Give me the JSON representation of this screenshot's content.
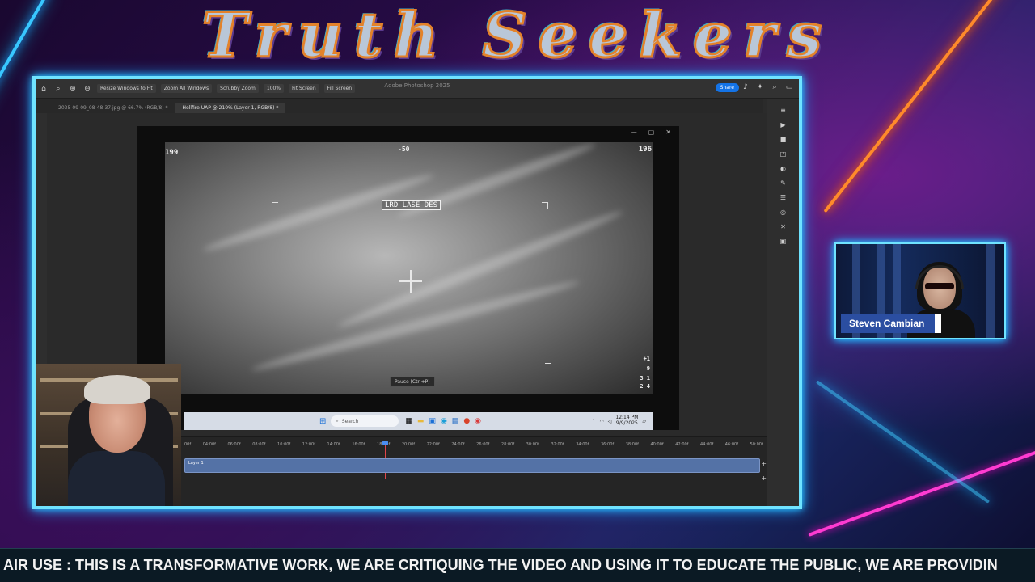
{
  "banner": {
    "title": "Truth Seekers"
  },
  "photoshop": {
    "app_title": "Adobe Photoshop 2025",
    "toolbar": {
      "resize_windows": "Resize Windows to Fit",
      "zoom_all": "Zoom All Windows",
      "scrubby_zoom": "Scrubby Zoom",
      "zoom_level": "100%",
      "fit_screen": "Fit Screen",
      "fill_screen": "Fill Screen",
      "share": "Share"
    },
    "tabs": [
      {
        "label": "2025-09-09_08-48-37.jpg @ 66.7% (RGB/8) *"
      },
      {
        "label": "Hellfire UAP @ 210% (Layer 1, RGB/8) *"
      }
    ],
    "timeline": {
      "ticks": [
        "00f",
        "04:00f",
        "06:00f",
        "08:00f",
        "10:00f",
        "12:00f",
        "14:00f",
        "16:00f",
        "18:00f",
        "20:00f",
        "22:00f",
        "24:00f",
        "26:00f",
        "28:00f",
        "30:00f",
        "32:00f",
        "34:00f",
        "36:00f",
        "38:00f",
        "40:00f",
        "42:00f",
        "44:00f",
        "46:00f",
        "50:00f"
      ],
      "layer": "Layer 1"
    }
  },
  "video": {
    "hud_top_left": "199",
    "hud_top_center": "-50",
    "hud_top_right": "196",
    "hud_box": "LRD LASE DES",
    "hud_bottom_right_1": "+1",
    "hud_bottom_right_2": "9",
    "hud_bottom_right_3": "3 1",
    "hud_bottom_right_4": "2 4",
    "tooltip": "Pause (Ctrl+P)"
  },
  "taskbar": {
    "search_placeholder": "Search",
    "time": "12:14 PM",
    "date": "9/9/2025"
  },
  "webcam_right": {
    "name": "Steven Cambian"
  },
  "ticker": {
    "text": "AIR USE : THIS IS A TRANSFORMATIVE WORK, WE ARE CRITIQUING THE VIDEO AND USING IT TO EDUCATE THE PUBLIC, WE ARE PROVIDIN"
  }
}
